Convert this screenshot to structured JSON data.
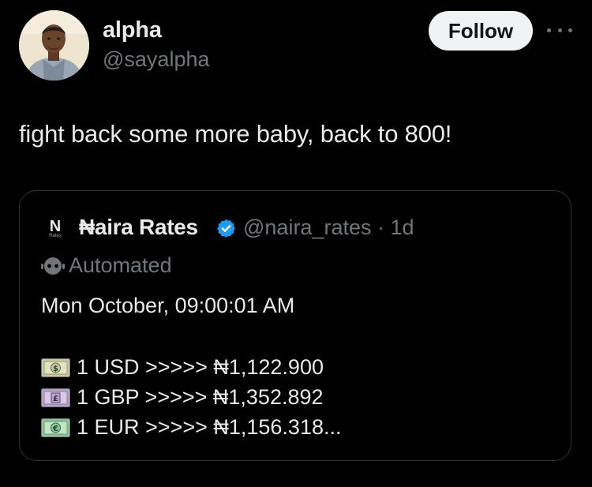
{
  "tweet": {
    "author_name": "alpha",
    "author_handle": "@sayalpha",
    "follow_label": "Follow",
    "text": "fight back some more baby, back to 800!"
  },
  "quote": {
    "avatar_letter": "N",
    "avatar_sub": "Rates",
    "name": "₦aira Rates",
    "handle_time": "@naira_rates · 1d",
    "automated_label": "Automated",
    "date_line": "Mon October, 09:00:01 AM",
    "rates": [
      {
        "icon": "dollar-banknote-icon",
        "text": "1 USD >>>>> ₦1,122.900"
      },
      {
        "icon": "pound-banknote-icon",
        "text": "1 GBP >>>>> ₦1,352.892"
      },
      {
        "icon": "euro-banknote-icon",
        "text": "1 EUR >>>>> ₦1,156.318..."
      }
    ]
  },
  "colors": {
    "background": "#000000",
    "primary_text": "#e7e9ea",
    "secondary_text": "#71767b",
    "verified_blue": "#1d9bf0",
    "follow_bg": "#eff3f4"
  }
}
